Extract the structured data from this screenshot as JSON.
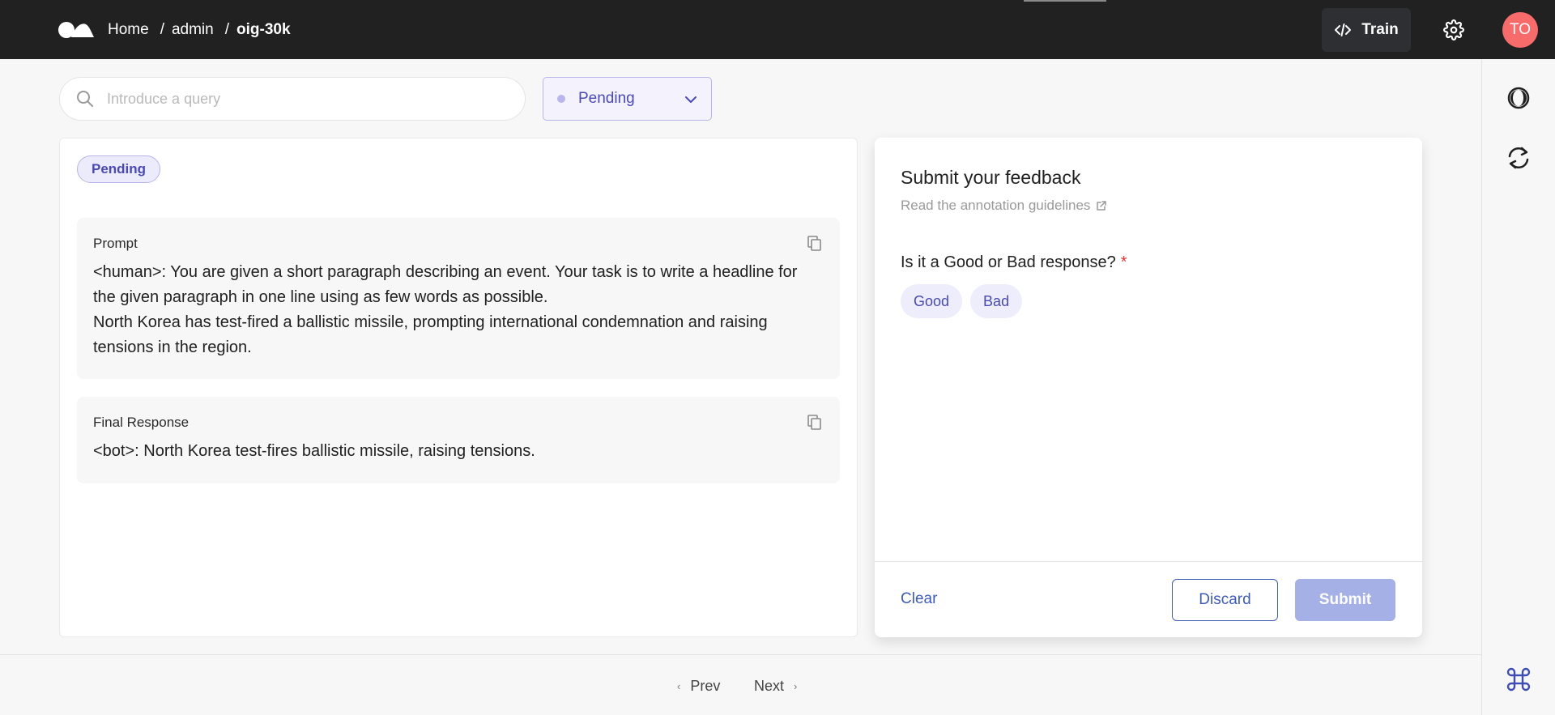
{
  "header": {
    "breadcrumb": {
      "home": "Home",
      "workspace": "admin",
      "dataset": "oig-30k"
    },
    "train_label": "Train",
    "avatar_initials": "TO"
  },
  "search": {
    "placeholder": "Introduce a query"
  },
  "status_filter": {
    "selected": "Pending"
  },
  "record": {
    "status": "Pending",
    "fields": [
      {
        "title": "Prompt",
        "text": "<human>: You are given a short paragraph describing an event. Your task is to write a headline for the given paragraph in one line using as few words as possible.\nNorth Korea has test-fired a ballistic missile, prompting international condemnation and raising tensions in the region."
      },
      {
        "title": "Final Response",
        "text": "<bot>: North Korea test-fires ballistic missile, raising tensions."
      }
    ]
  },
  "feedback": {
    "title": "Submit your feedback",
    "guidelines_link": "Read the annotation guidelines",
    "question": "Is it a Good or Bad response?",
    "required_mark": "*",
    "options": [
      "Good",
      "Bad"
    ],
    "clear_label": "Clear",
    "discard_label": "Discard",
    "submit_label": "Submit"
  },
  "pagination": {
    "prev_label": "Prev",
    "next_label": "Next"
  },
  "icons": {
    "logo": "brand-logo",
    "train": "code-icon",
    "settings": "gear-icon",
    "theme": "dark-mode-icon",
    "refresh": "refresh-icon",
    "shortcuts": "command-key-icon",
    "search": "search-icon",
    "copy": "copy-icon",
    "external": "external-link-icon"
  },
  "colors": {
    "header_bg": "#212121",
    "accent": "#4b4ab3",
    "primary_button": "#a4b0e6",
    "link": "#3e5bb5",
    "avatar_bg": "#f76b6b"
  }
}
